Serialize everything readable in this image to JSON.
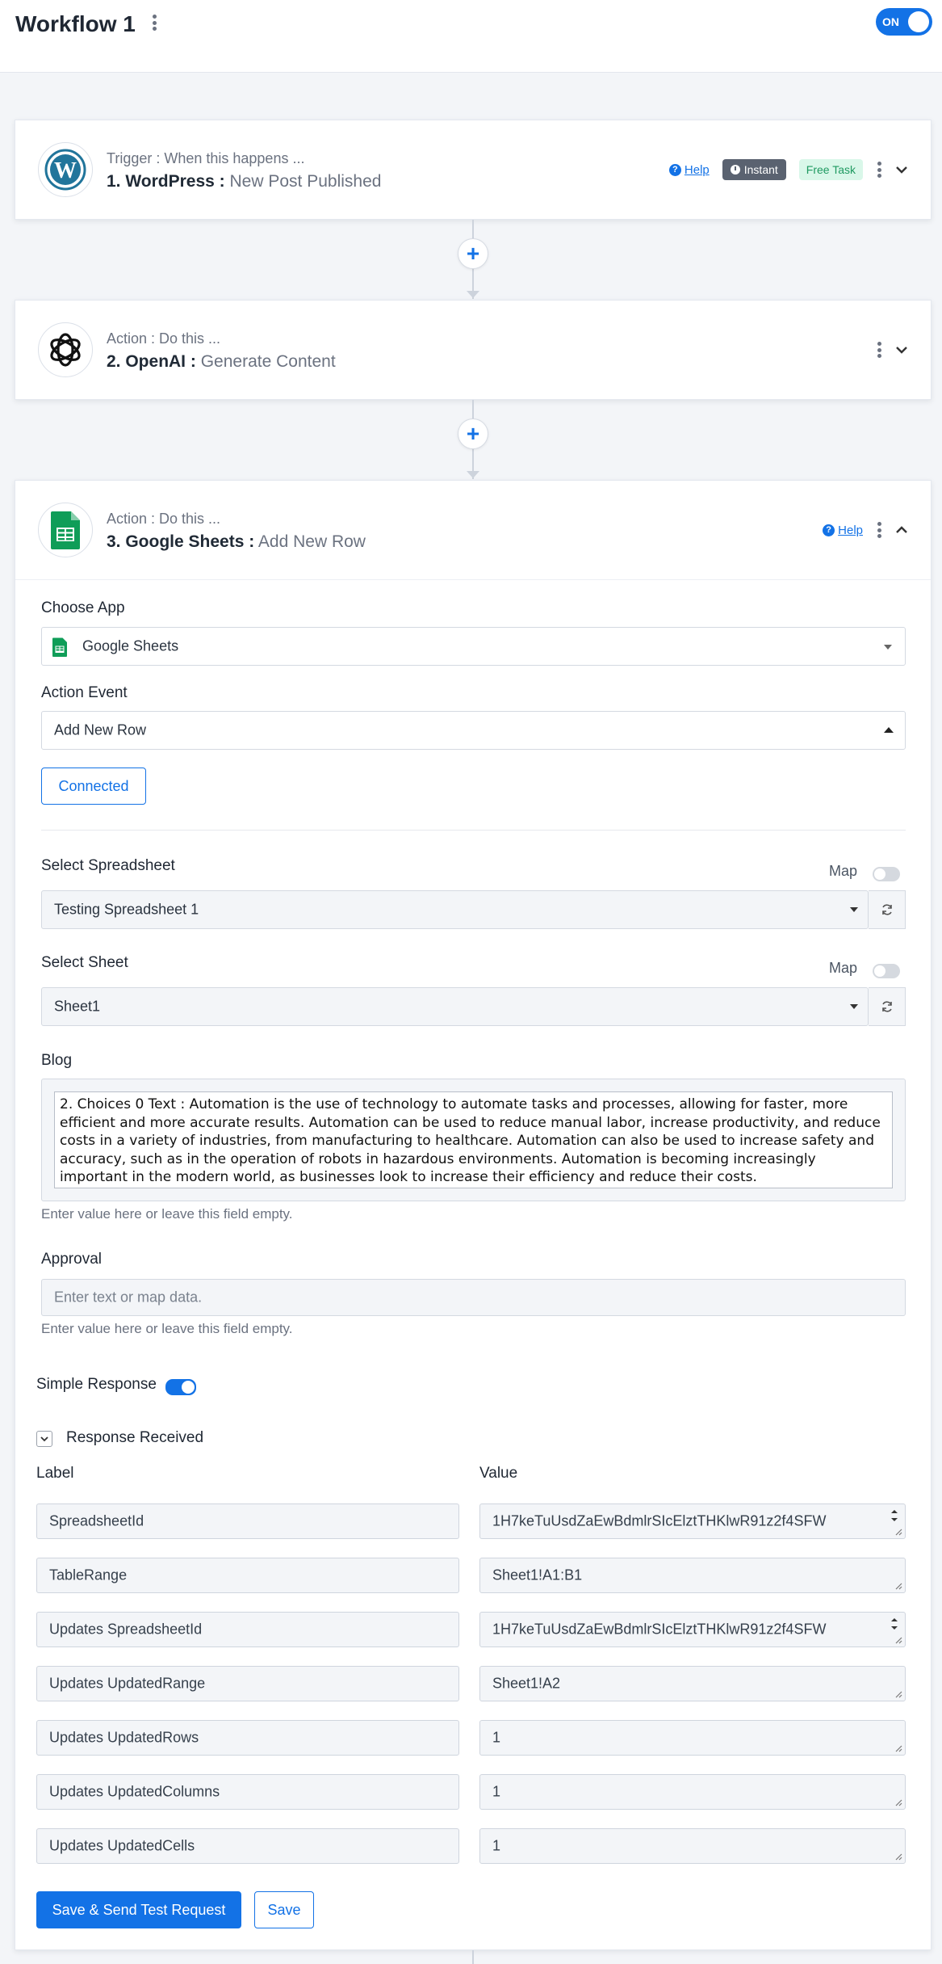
{
  "workflow": {
    "title": "Workflow 1",
    "toggle_label": "ON"
  },
  "steps": [
    {
      "sub": "Trigger : When this happens ...",
      "title": "1. WordPress :",
      "event": "New Post Published",
      "help": "Help",
      "badge_instant": "Instant",
      "badge_free": "Free Task"
    },
    {
      "sub": "Action : Do this ...",
      "title": "2. OpenAI :",
      "event": "Generate Content"
    },
    {
      "sub": "Action : Do this ...",
      "title": "3. Google Sheets :",
      "event": "Add New Row",
      "help": "Help"
    }
  ],
  "form": {
    "choose_app_label": "Choose App",
    "choose_app_value": "Google Sheets",
    "action_event_label": "Action Event",
    "action_event_value": "Add New Row",
    "connected_label": "Connected",
    "map_label": "Map",
    "spreadsheet_label": "Select Spreadsheet",
    "spreadsheet_value": "Testing Spreadsheet 1",
    "sheet_label": "Select Sheet",
    "sheet_value": "Sheet1",
    "blog_label": "Blog",
    "blog_value": "2. Choices 0 Text : Automation is the use of technology to automate tasks and processes, allowing for faster, more efficient and more accurate results. Automation can be used to reduce manual labor, increase productivity, and reduce costs in a variety of industries, from manufacturing to healthcare. Automation can also be used to increase safety and accuracy, such as in the operation of robots in hazardous environments. Automation is becoming increasingly important in the modern world, as businesses look to increase their efficiency and reduce their costs.",
    "blog_hint": "Enter value here or leave this field empty.",
    "approval_label": "Approval",
    "approval_placeholder": "Enter text or map data.",
    "approval_hint": "Enter value here or leave this field empty."
  },
  "response": {
    "simple_response_label": "Simple Response",
    "received_label": "Response Received",
    "label_header": "Label",
    "value_header": "Value",
    "rows": [
      {
        "label": "SpreadsheetId",
        "value": "1H7keTuUsdZaEwBdmlrSIcElztTHKlwR91z2f4SFW"
      },
      {
        "label": "TableRange",
        "value": "Sheet1!A1:B1"
      },
      {
        "label": "Updates SpreadsheetId",
        "value": "1H7keTuUsdZaEwBdmlrSIcElztTHKlwR91z2f4SFW"
      },
      {
        "label": "Updates UpdatedRange",
        "value": "Sheet1!A2"
      },
      {
        "label": "Updates UpdatedRows",
        "value": "1"
      },
      {
        "label": "Updates UpdatedColumns",
        "value": "1"
      },
      {
        "label": "Updates UpdatedCells",
        "value": "1"
      }
    ]
  },
  "buttons": {
    "save_send": "Save & Send Test Request",
    "save": "Save"
  },
  "colors": {
    "accent": "#1372e6",
    "free_badge_bg": "#d9f7e9",
    "instant_badge_bg": "#5a6270"
  }
}
